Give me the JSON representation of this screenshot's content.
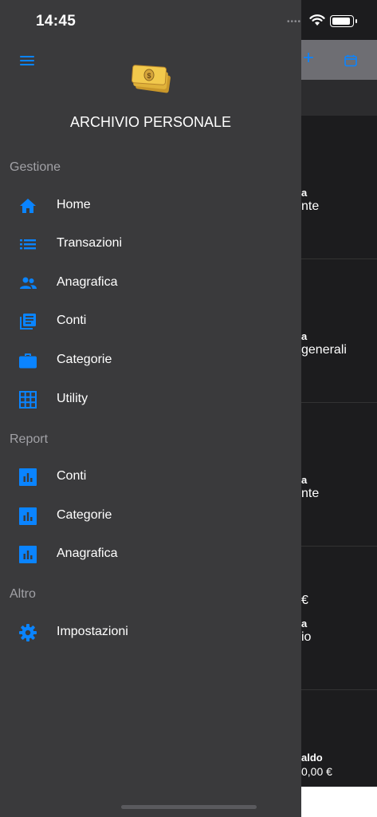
{
  "status_bar": {
    "time": "14:45"
  },
  "drawer": {
    "title": "ARCHIVIO PERSONALE",
    "sections": [
      {
        "header": "Gestione",
        "items": [
          {
            "label": "Home",
            "icon": "home-icon"
          },
          {
            "label": "Transazioni",
            "icon": "list-icon"
          },
          {
            "label": "Anagrafica",
            "icon": "people-icon"
          },
          {
            "label": "Conti",
            "icon": "library-books-icon"
          },
          {
            "label": "Categorie",
            "icon": "briefcase-icon"
          },
          {
            "label": "Utility",
            "icon": "grid-icon"
          }
        ]
      },
      {
        "header": "Report",
        "items": [
          {
            "label": "Conti",
            "icon": "bar-chart-icon"
          },
          {
            "label": "Categorie",
            "icon": "bar-chart-icon"
          },
          {
            "label": "Anagrafica",
            "icon": "bar-chart-icon"
          }
        ]
      },
      {
        "header": "Altro",
        "items": [
          {
            "label": "Impostazioni",
            "icon": "gear-icon"
          }
        ]
      }
    ]
  },
  "background": {
    "cards": [
      {
        "label": "a",
        "text": "nte"
      },
      {
        "label": "a",
        "text": "generali"
      },
      {
        "label": "a",
        "text": "nte"
      },
      {
        "amount": "€",
        "label": "a",
        "text": "io"
      }
    ],
    "footer": {
      "label": "aldo",
      "value": "0,00 €"
    }
  },
  "colors": {
    "accent": "#0a84ff",
    "drawer_bg": "#3a3a3c",
    "app_bg": "#1c1c1e"
  }
}
